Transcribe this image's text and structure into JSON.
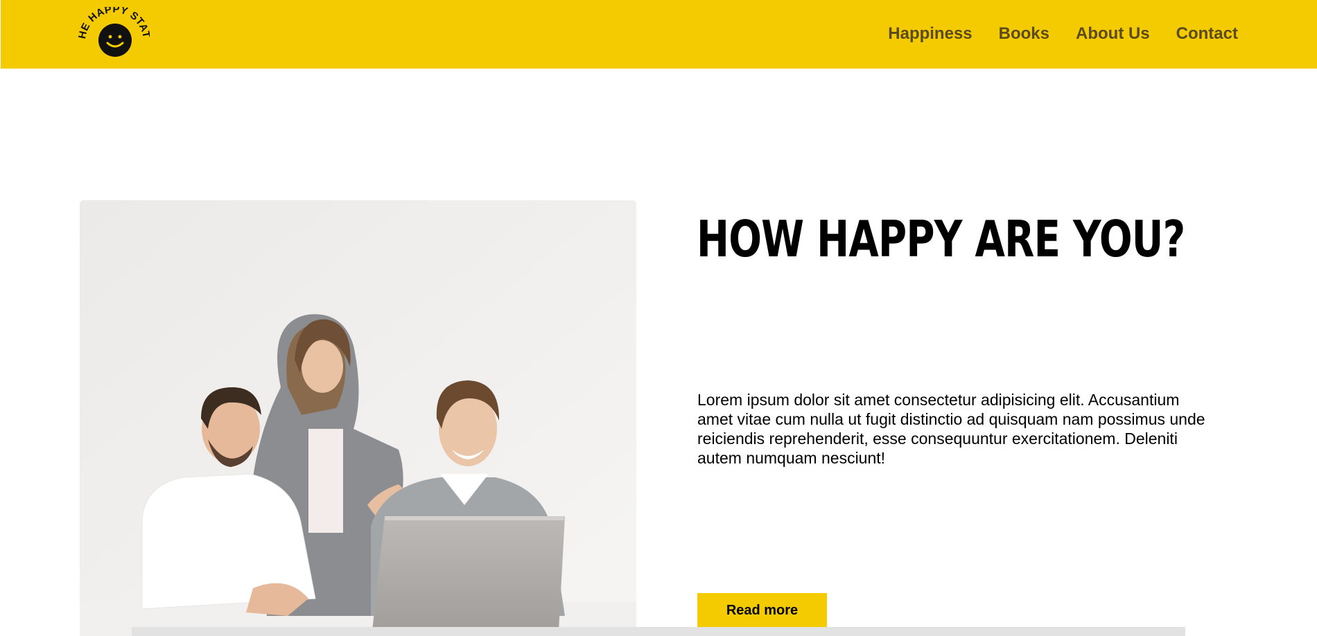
{
  "logo": {
    "text": "THE HAPPY STATS",
    "icon": "smiley-face-icon"
  },
  "nav": {
    "items": [
      {
        "label": "Happiness"
      },
      {
        "label": "Books"
      },
      {
        "label": "About Us"
      },
      {
        "label": "Contact"
      }
    ]
  },
  "hero": {
    "title": "HOW HAPPY ARE YOU?",
    "body": "Lorem ipsum dolor sit amet consectetur adipisicing elit. Accusantium amet vitae cum nulla ut fugit distinctio ad quisquam nam possimus unde reiciendis reprehenderit, esse consequuntur exercitationem. Deleniti autem numquam nesciunt!",
    "button_label": "Read more"
  },
  "colors": {
    "brand_yellow": "#f4cb00",
    "nav_text": "#5b4a1c"
  }
}
